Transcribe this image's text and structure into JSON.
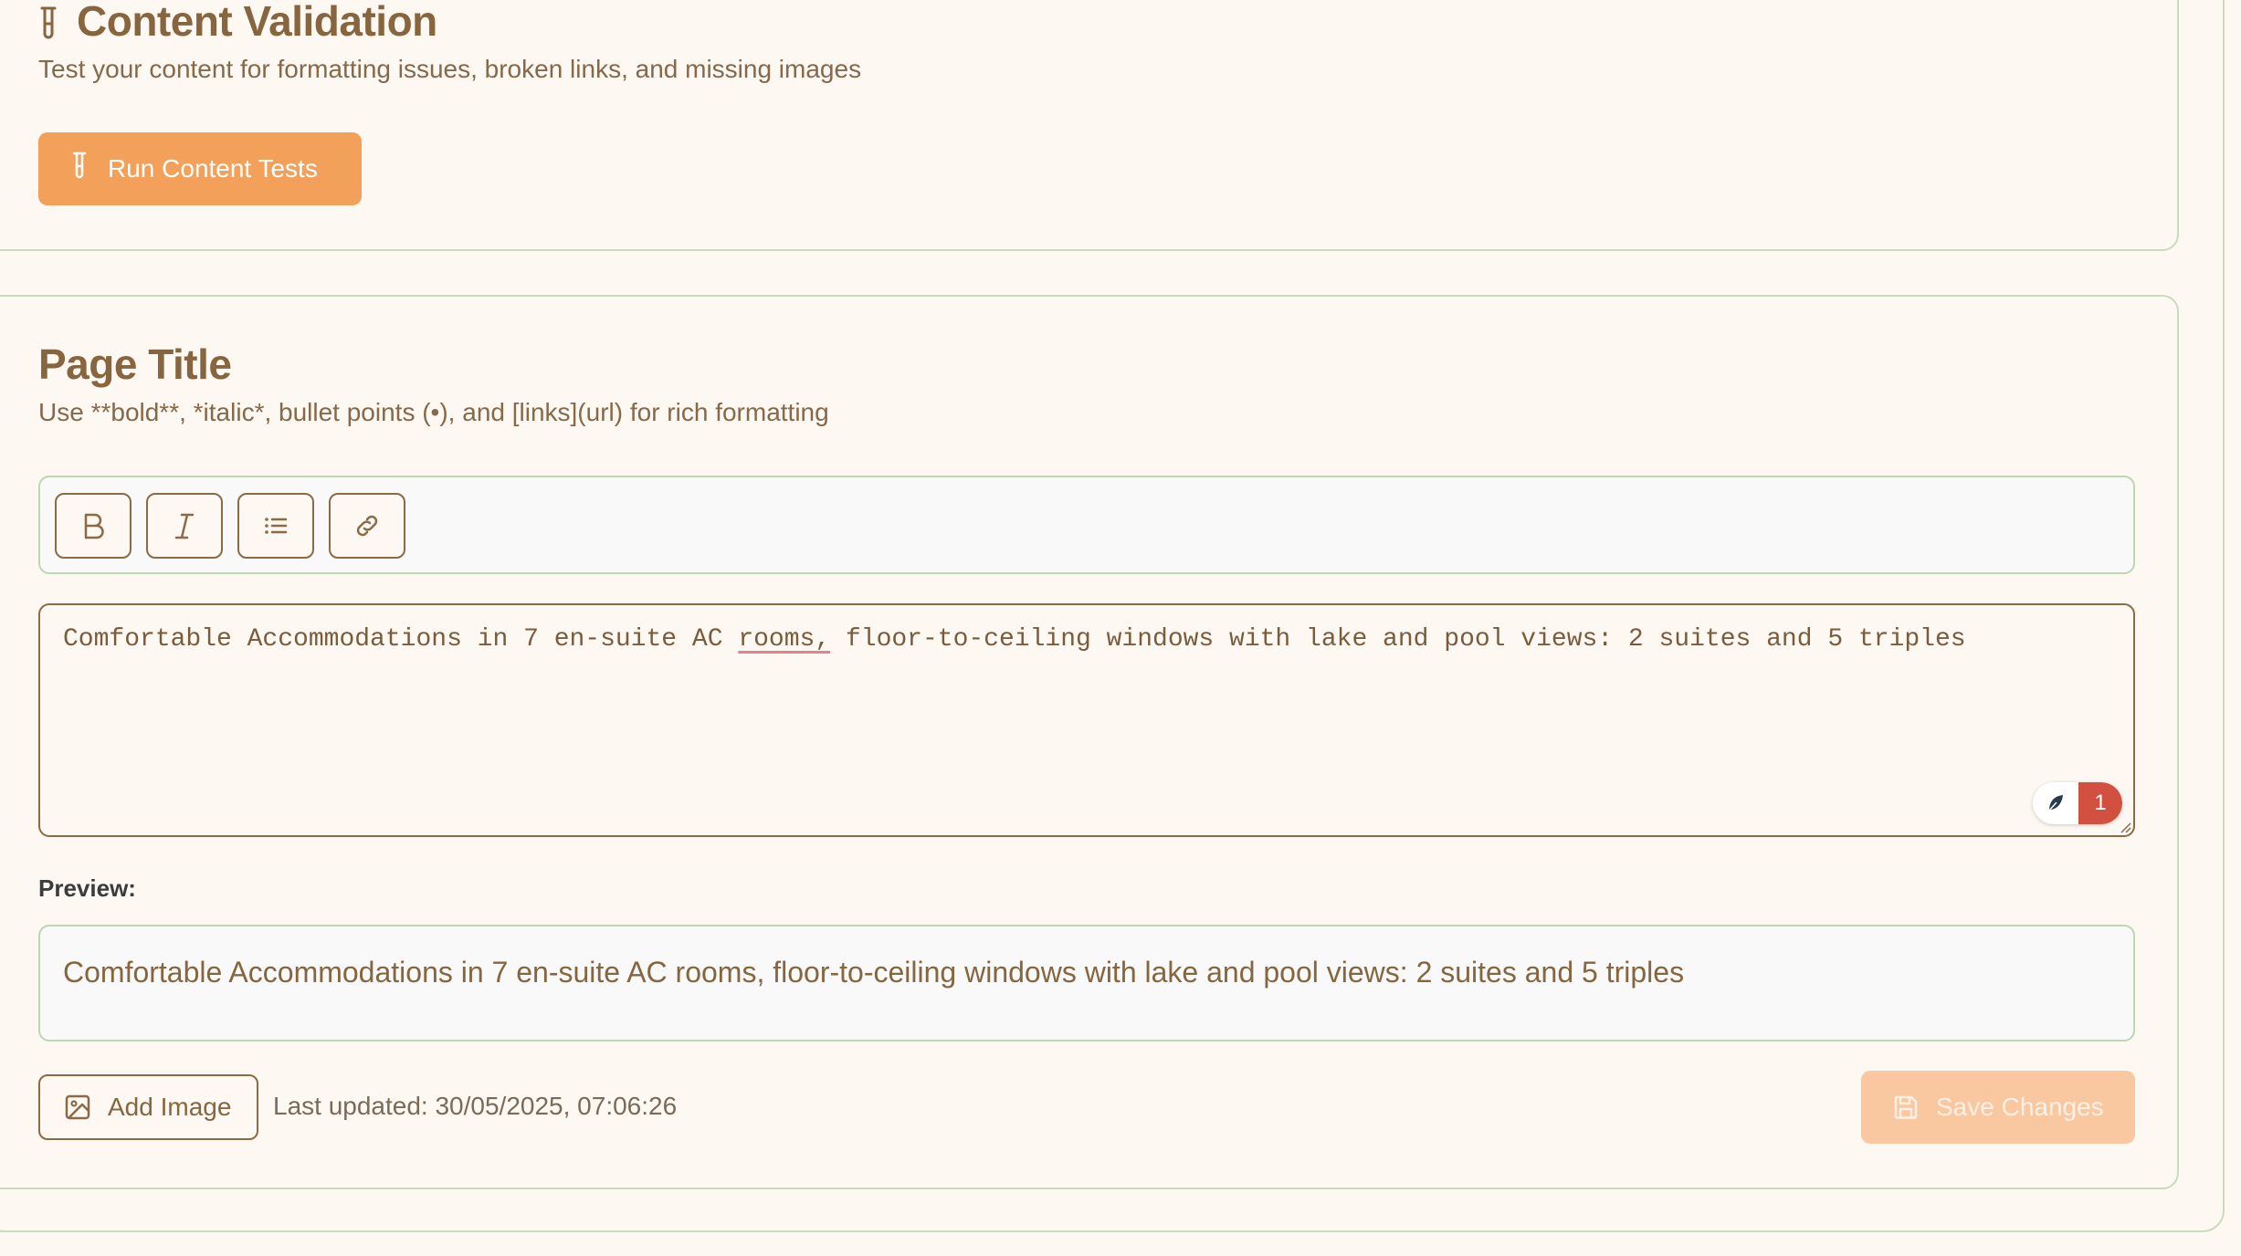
{
  "validation": {
    "title": "Content Validation",
    "subtitle": "Test your content for formatting issues, broken links, and missing images",
    "run_button": "Run Content Tests"
  },
  "page_title_section": {
    "title": "Page Title",
    "hint": "Use **bold**, *italic*, bullet points (•), and [links](url) for rich formatting",
    "toolbar": [
      "bold-icon",
      "italic-icon",
      "list-icon",
      "link-icon"
    ],
    "editor_text_before": "Comfortable Accommodations in 7 en-suite AC ",
    "editor_text_flagged": "rooms,",
    "editor_text_after": " floor-to-ceiling windows with lake and pool views: 2 suites and 5 triples",
    "grammar_issue_count": "1",
    "preview_label": "Preview:",
    "preview_text": "Comfortable Accommodations in 7 en-suite AC rooms, floor-to-ceiling windows with lake and pool views: 2 suites and 5 triples",
    "add_image_button": "Add Image",
    "last_updated": "Last updated: 30/05/2025, 07:06:26",
    "save_button": "Save Changes"
  },
  "colors": {
    "accent": "#f3a05a",
    "accent_disabled": "#f9c8a0",
    "border_green": "#c9dcbf",
    "text_brown": "#87663f",
    "badge_red": "#d2503f"
  }
}
